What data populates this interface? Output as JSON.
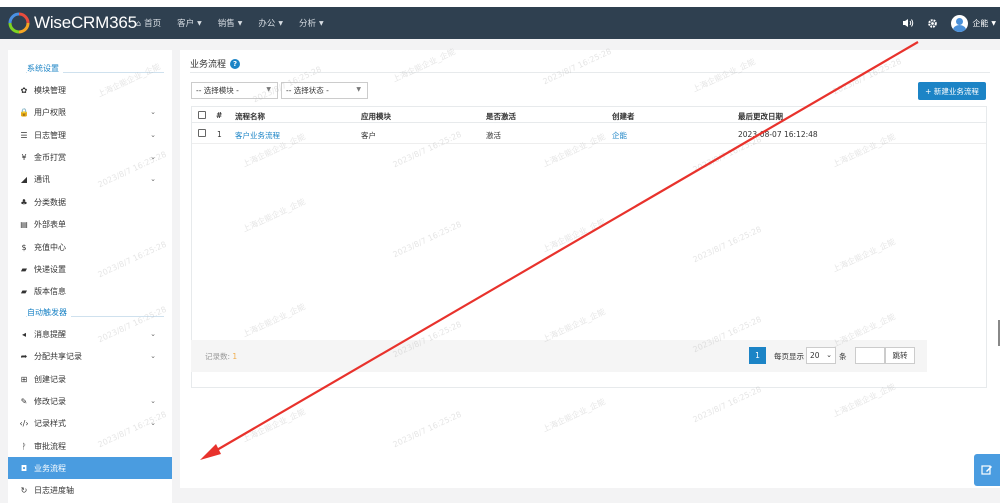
{
  "app": {
    "logo_text": "WiseCRM365",
    "colors": {
      "navbar": "#2f4050",
      "accent": "#1c84c6",
      "active": "#4a9ce0",
      "arrow": "#e8322c"
    }
  },
  "nav": {
    "items": [
      {
        "label": "首页",
        "icon": "home-icon",
        "has_caret": false
      },
      {
        "label": "客户",
        "has_caret": true
      },
      {
        "label": "销售",
        "has_caret": true
      },
      {
        "label": "办公",
        "has_caret": true
      },
      {
        "label": "分析",
        "has_caret": true
      }
    ],
    "user_name": "企能"
  },
  "sidebar": {
    "section1": "系统设置",
    "section2": "自动触发器",
    "items": [
      {
        "label": "模块管理",
        "icon": "gear-icon",
        "glyph": "✿",
        "chevron": false
      },
      {
        "label": "用户权限",
        "icon": "lock-icon",
        "glyph": "🔒",
        "chevron": true
      },
      {
        "label": "日志管理",
        "icon": "list-icon",
        "glyph": "☰",
        "chevron": true
      },
      {
        "label": "金币打赏",
        "icon": "yen-icon",
        "glyph": "¥",
        "chevron": true
      },
      {
        "label": "通讯",
        "icon": "send-icon",
        "glyph": "◢",
        "chevron": true
      },
      {
        "label": "分类数据",
        "icon": "sitemap-icon",
        "glyph": "♣",
        "chevron": false
      },
      {
        "label": "外部表单",
        "icon": "card-icon",
        "glyph": "▤",
        "chevron": false
      },
      {
        "label": "充值中心",
        "icon": "dollar-icon",
        "glyph": "$",
        "chevron": false
      },
      {
        "label": "快递设置",
        "icon": "truck-icon",
        "glyph": "▰",
        "chevron": false
      },
      {
        "label": "版本信息",
        "icon": "book-icon",
        "glyph": "▰",
        "chevron": false
      },
      {
        "label": "消息提醒",
        "icon": "volume-icon",
        "glyph": "◂",
        "chevron": true
      },
      {
        "label": "分配共享记录",
        "icon": "share-icon",
        "glyph": "➦",
        "chevron": true
      },
      {
        "label": "创建记录",
        "icon": "plus-square-icon",
        "glyph": "⊞",
        "chevron": false
      },
      {
        "label": "修改记录",
        "icon": "pencil-icon",
        "glyph": "✎",
        "chevron": true
      },
      {
        "label": "记录样式",
        "icon": "code-icon",
        "glyph": "‹/›",
        "chevron": true
      },
      {
        "label": "审批流程",
        "icon": "approve-icon",
        "glyph": "ᚹ",
        "chevron": false
      },
      {
        "label": "业务流程",
        "icon": "shield-icon",
        "glyph": "◘",
        "chevron": false,
        "active": true
      },
      {
        "label": "日志进度轴",
        "icon": "history-icon",
        "glyph": "↻",
        "chevron": false
      }
    ]
  },
  "main": {
    "title": "业务流程",
    "filter_module": "-- 选择模块 -",
    "filter_status": "-- 选择状态 -",
    "new_button": "+ 新建业务流程",
    "columns": [
      "#",
      "流程名称",
      "应用模块",
      "是否激活",
      "创建者",
      "最后更改日期"
    ],
    "rows": [
      {
        "num": "1",
        "name": "客户业务流程",
        "module": "客户",
        "active": "激活",
        "creator": "企能",
        "modified": "2023-08-07 16:12:48"
      }
    ],
    "record_count_label": "记录数: ",
    "record_count": "1",
    "page": "1",
    "per_page_label": "每页显示",
    "per_page": "20",
    "per_page_unit": "条",
    "jump_label": "跳转"
  },
  "watermarks": [
    "上海企能企业_企能",
    "2023/8/7 16:25:28"
  ]
}
